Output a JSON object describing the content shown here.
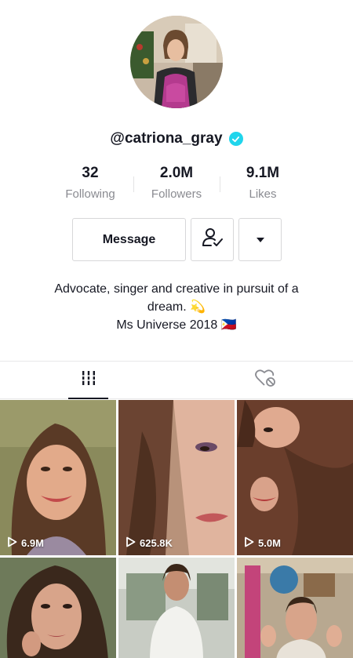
{
  "profile": {
    "username": "@catriona_gray",
    "verified": true
  },
  "stats": [
    {
      "value": "32",
      "label": "Following"
    },
    {
      "value": "2.0M",
      "label": "Followers"
    },
    {
      "value": "9.1M",
      "label": "Likes"
    }
  ],
  "actions": {
    "message_label": "Message",
    "follow_icon": "user-check-icon",
    "more_icon": "caret-down-icon"
  },
  "bio": {
    "line1": "Advocate, singer and creative in pursuit of a",
    "line2": "dream. 💫",
    "line3": "Ms Universe 2018 🇵🇭"
  },
  "tabs": [
    {
      "icon": "videos-grid-icon",
      "active": true
    },
    {
      "icon": "liked-videos-icon",
      "active": false
    }
  ],
  "videos": [
    {
      "views": "6.9M"
    },
    {
      "views": "625.8K"
    },
    {
      "views": "5.0M"
    },
    {
      "views": ""
    },
    {
      "views": ""
    },
    {
      "views": ""
    }
  ],
  "colors": {
    "verified_badge": "#20d5ec",
    "text_primary": "#161823",
    "text_secondary": "#8a8b91"
  }
}
